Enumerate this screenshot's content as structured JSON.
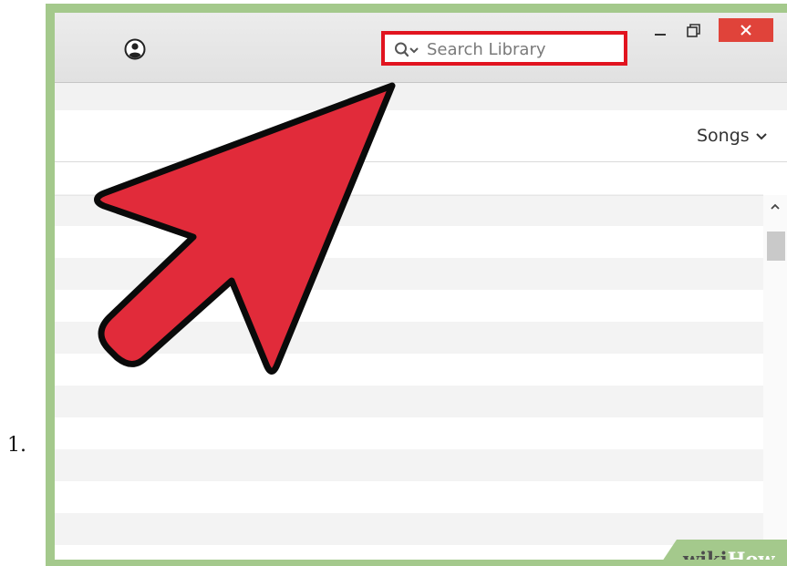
{
  "step": {
    "number": "1."
  },
  "window": {
    "account_icon": "user-account-icon",
    "search": {
      "placeholder": "Search Library",
      "icon": "search-icon",
      "highlight_color": "#e1141f"
    },
    "controls": {
      "minimize_icon": "minimize-icon",
      "restore_icon": "restore-icon",
      "close_icon": "close-icon",
      "close_color": "#e0433a"
    },
    "toolbar": {
      "view_label": "Songs",
      "view_icon": "chevron-down-icon"
    },
    "scrollbar": {
      "up_icon": "chevron-up-icon"
    }
  },
  "annotation": {
    "arrow_color": "#e12b3a",
    "arrow_icon": "pointer-arrow-icon"
  },
  "watermark": {
    "wiki": "wiki",
    "how": "How",
    "color": "#a4c98c"
  }
}
